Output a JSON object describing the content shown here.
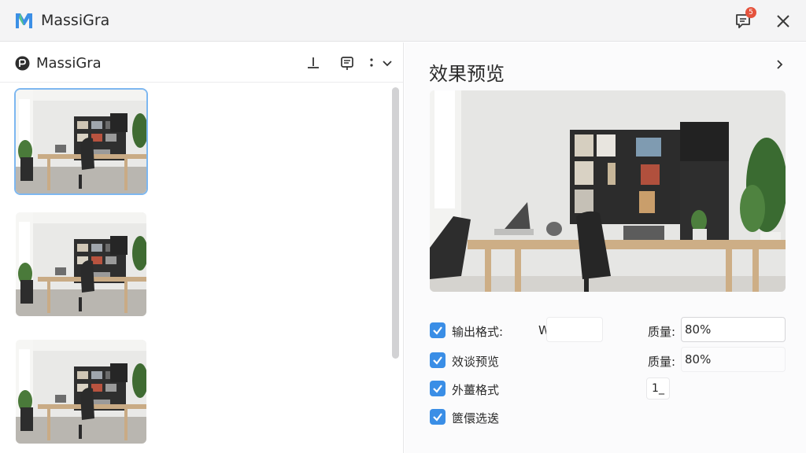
{
  "app": {
    "title": "MassiGra",
    "notification_count": "5"
  },
  "left_panel": {
    "title": "MassiGra"
  },
  "right_panel": {
    "title": "效果预览",
    "options": [
      {
        "label": "输出格式:",
        "value": "WebP",
        "checked": true
      },
      {
        "label": "效谈预览",
        "checked": true
      },
      {
        "label": "外薑格式",
        "checked": true
      },
      {
        "label": "篋儇选逘",
        "checked": true
      }
    ],
    "quality": [
      {
        "label": "质量:",
        "value": "80%"
      },
      {
        "label": "质量:",
        "value": "80%"
      }
    ],
    "mini_button_label": "1_"
  },
  "colors": {
    "accent": "#3a8ee6",
    "selected_outline": "#7db7f0",
    "badge": "#e5533d"
  },
  "icons": [
    "app-logo-icon",
    "notification-icon",
    "close-icon",
    "download-icon",
    "export-icon",
    "more-icon",
    "chevron-down-icon",
    "chevron-right-icon",
    "check-icon"
  ]
}
